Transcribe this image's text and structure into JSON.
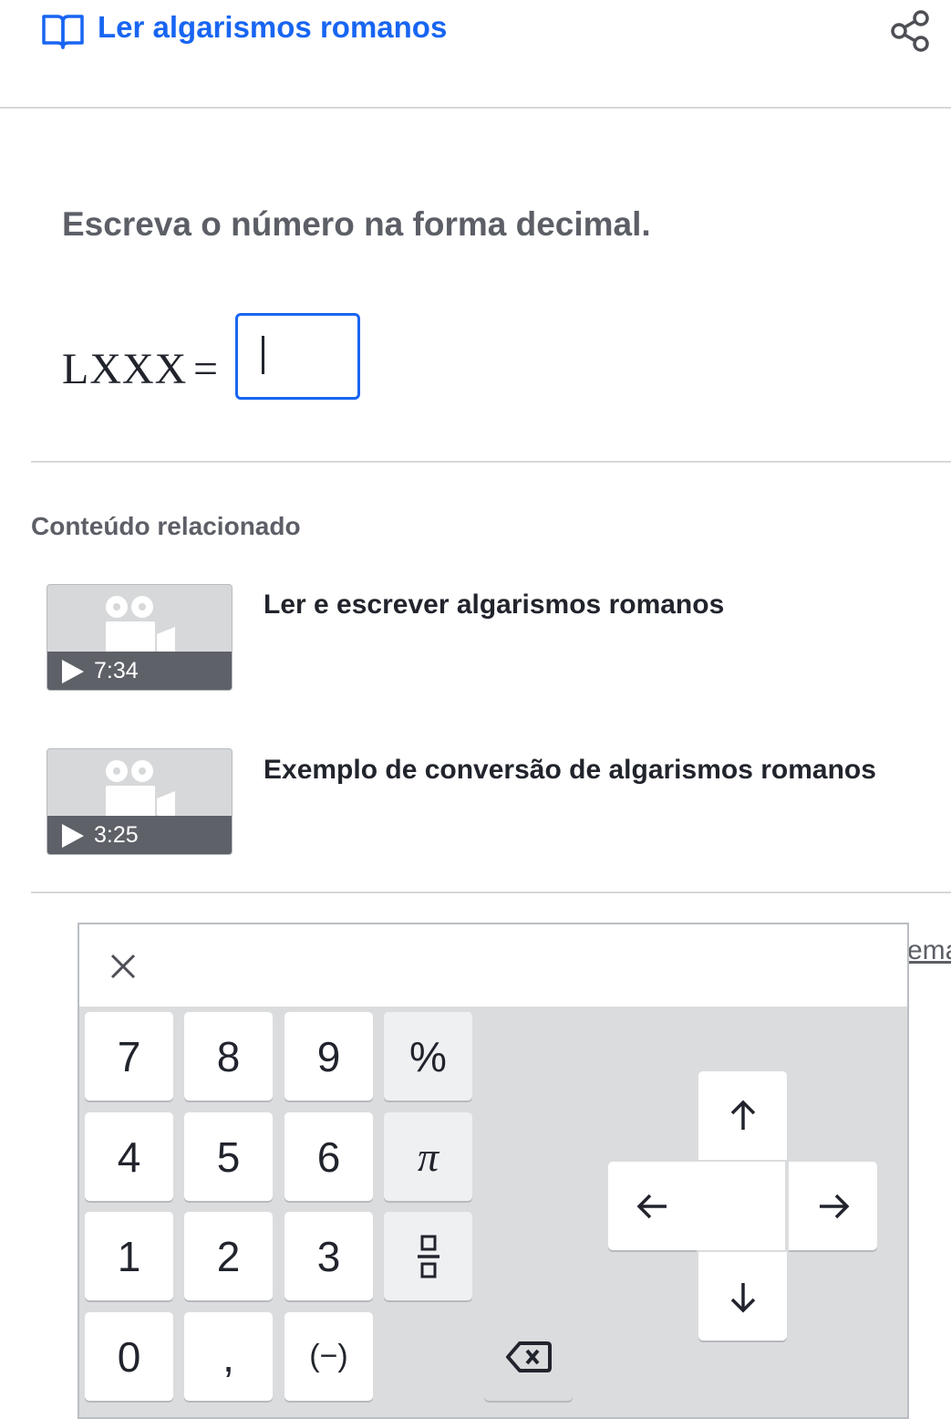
{
  "header": {
    "title": "Ler algarismos romanos",
    "book_icon": "book-open-icon",
    "share_icon": "share-icon",
    "accent_color": "#1865f2"
  },
  "question": {
    "prompt": "Escreva o número na forma decimal.",
    "roman_numeral": "LXXX",
    "equals": "=",
    "answer_value": ""
  },
  "related": {
    "heading": "Conteúdo relacionado",
    "videos": [
      {
        "title": "Ler e escrever algarismos romanos",
        "duration": "7:34"
      },
      {
        "title": "Exemplo de conversão de algarismos romanos",
        "duration": "3:25"
      }
    ]
  },
  "background_link_fragment": "ema",
  "keypad": {
    "close_icon": "close-icon",
    "keys": {
      "k7": "7",
      "k8": "8",
      "k9": "9",
      "percent": "%",
      "k4": "4",
      "k5": "5",
      "k6": "6",
      "pi": "π",
      "k1": "1",
      "k2": "2",
      "k3": "3",
      "k0": "0",
      "comma": ",",
      "negative": "(−)"
    },
    "icons": {
      "fraction": "fraction-icon",
      "backspace": "backspace-icon",
      "up": "arrow-up-icon",
      "down": "arrow-down-icon",
      "left": "arrow-left-icon",
      "right": "arrow-right-icon"
    }
  }
}
